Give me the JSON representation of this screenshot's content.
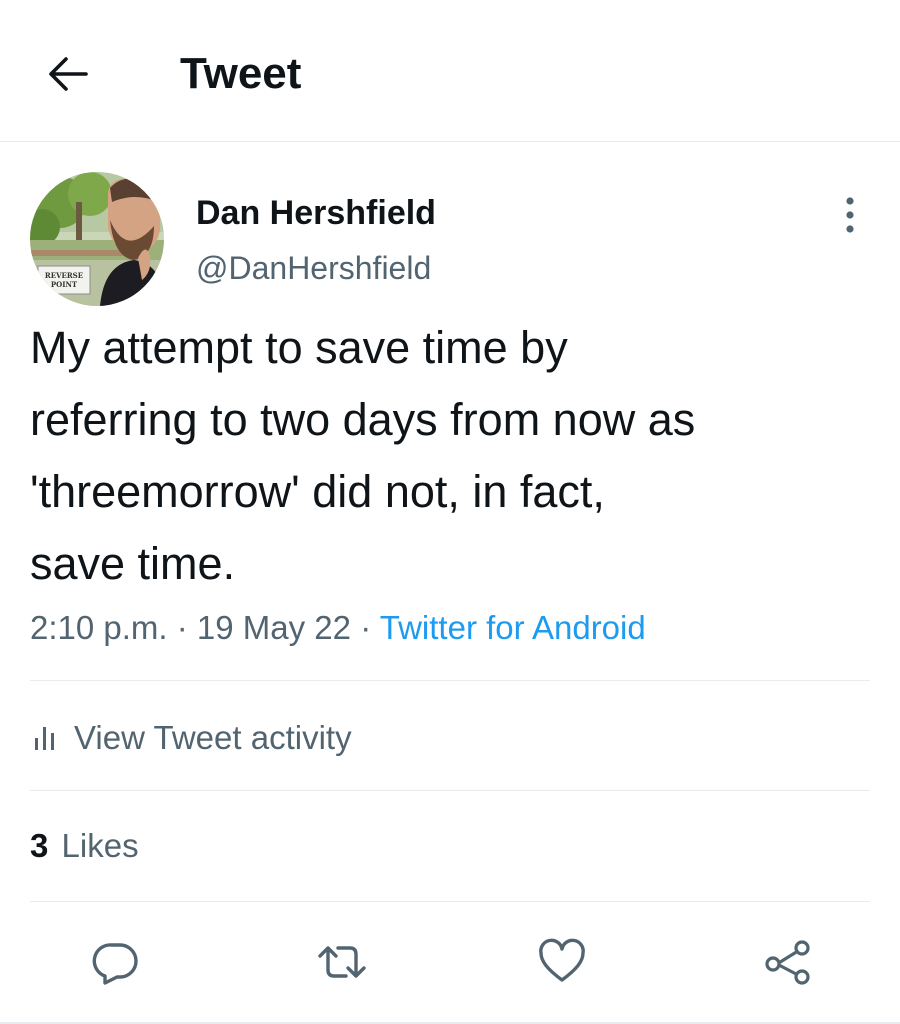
{
  "header": {
    "title": "Tweet",
    "back_icon": "arrow-left-icon"
  },
  "author": {
    "name": "Dan Hershfield",
    "handle": "@DanHershfield",
    "avatar_sign_text": "REVERSE POINT",
    "more_icon": "more-vertical-icon"
  },
  "tweet": {
    "text": "My attempt to save time by\nreferring to two days from now as\n'threemorrow' did not, in fact,\nsave time.",
    "time": "2:10 p.m.",
    "date": "19 May 22",
    "separator": "·",
    "source": "Twitter for Android"
  },
  "activity": {
    "label": "View Tweet activity",
    "icon": "bar-chart-icon"
  },
  "stats": {
    "likes_count": "3",
    "likes_label": "Likes"
  },
  "actions": [
    {
      "name": "reply",
      "icon": "reply-icon"
    },
    {
      "name": "retweet",
      "icon": "retweet-icon"
    },
    {
      "name": "like",
      "icon": "heart-icon"
    },
    {
      "name": "share",
      "icon": "share-icon"
    }
  ],
  "colors": {
    "text_primary": "#0f1419",
    "text_secondary": "#536471",
    "link_blue": "#1d9bf0",
    "divider": "#e7ecf0"
  }
}
